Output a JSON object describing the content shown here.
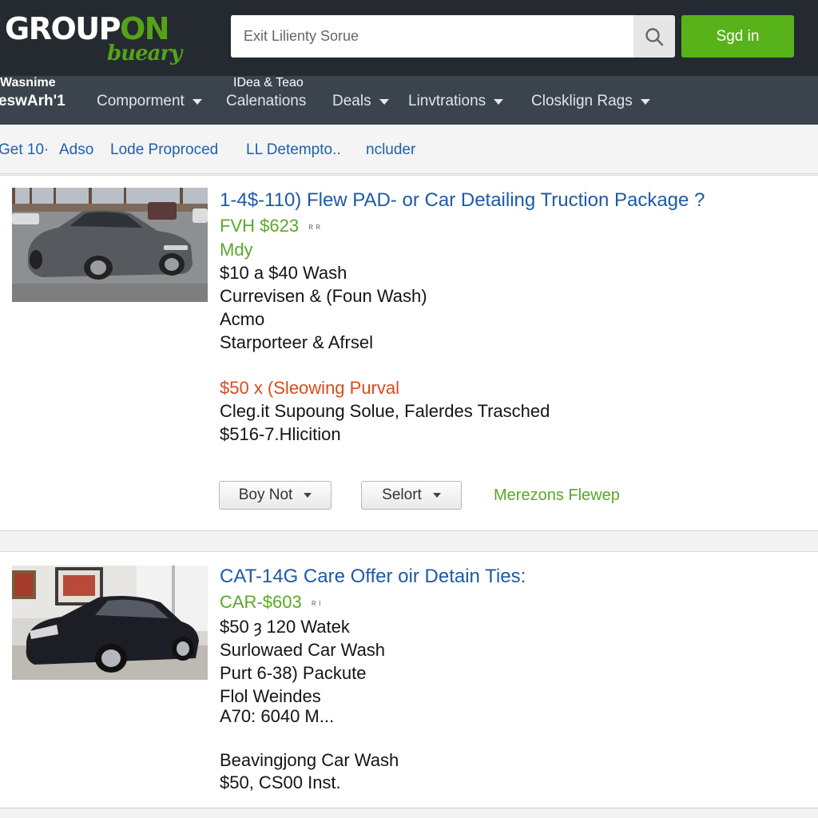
{
  "header": {
    "logo_text": "GROUPON",
    "logo_tagline": "bueary",
    "search": {
      "placeholder": "Exit Lilienty Sorue"
    },
    "signin_label": "Sgd in"
  },
  "nav": {
    "top_left": "Wasnime",
    "top_mid": "IDea & Teao",
    "location": "eswArh'1",
    "items": [
      {
        "label": "Comporment",
        "has_caret": true
      },
      {
        "label": "Calenations",
        "has_caret": false
      },
      {
        "label": "Deals",
        "has_caret": true
      },
      {
        "label": "Linvtrations",
        "has_caret": true
      },
      {
        "label": "Closklign Rags",
        "has_caret": true
      }
    ]
  },
  "subnav": {
    "items": [
      "Get 10·",
      "Adso",
      "Lode Proproced",
      "LL Detempto..",
      "ncluder"
    ]
  },
  "deals": [
    {
      "title": "1-4$-110) Flew PAD- or Car Detailing Truction Package ?",
      "price": "FVH $623",
      "price_note": "ʀ ʀ",
      "lines": [
        {
          "text": "Mdy",
          "style": "green"
        },
        {
          "text": "$10 a $40 Wash",
          "style": "normal"
        },
        {
          "text": "Currevisen & (Foun Wash)",
          "style": "normal"
        },
        {
          "text": "Acmo",
          "style": "normal"
        },
        {
          "text": "Starporteer & Afrsel",
          "style": "normal"
        },
        {
          "text": "$50 x (Sleowing Purval",
          "style": "orange"
        },
        {
          "text": "Cleg.it Supoung Solue, Falerdes Trasched",
          "style": "normal"
        },
        {
          "text": "$516-7.Hlicition",
          "style": "normal"
        }
      ],
      "select_1": "Boy Not",
      "select_2": "Selort",
      "more_link": "Merezons Flewep"
    },
    {
      "title": "CAT-14G Care Offer oir Detain Ties:",
      "price": "CAR-$603",
      "price_note": "ʀ ı",
      "lines": [
        {
          "text": "$50 ȝ 120 Watek",
          "style": "normal"
        },
        {
          "text": "Surlowaed Car Wash",
          "style": "normal"
        },
        {
          "text": "Purt 6-38) Packute",
          "style": "normal"
        },
        {
          "text": "Flol Weindes",
          "style": "normal"
        },
        {
          "text": "A70: 6040 M...",
          "style": "normal"
        },
        {
          "text": "Beavingjong Car Wash",
          "style": "normal"
        },
        {
          "text": "$50, CS00 Inst.",
          "style": "normal"
        }
      ]
    }
  ],
  "colors": {
    "header_bg": "#252a30",
    "nav_bg": "#3b444d",
    "brand_green": "#53a318",
    "link_blue": "#1d5aa6",
    "accent_orange": "#d94a1c"
  }
}
